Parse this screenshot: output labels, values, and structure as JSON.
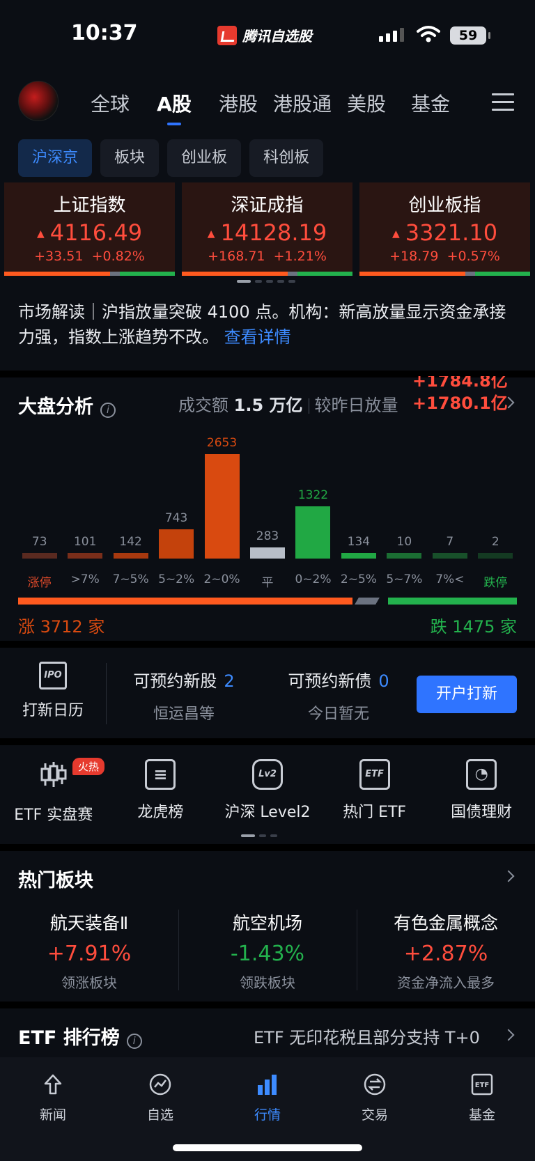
{
  "status_bar": {
    "time": "10:37",
    "app_name": "腾讯自选股",
    "battery": "59"
  },
  "top_nav": {
    "tabs": [
      {
        "label": "全球",
        "active": false
      },
      {
        "label": "A股",
        "active": true
      },
      {
        "label": "港股",
        "active": false
      },
      {
        "label": "港股通",
        "active": false
      },
      {
        "label": "美股",
        "active": false
      },
      {
        "label": "基金",
        "active": false
      }
    ]
  },
  "sub_tabs": [
    {
      "label": "沪深京",
      "active": true
    },
    {
      "label": "板块",
      "active": false
    },
    {
      "label": "创业板",
      "active": false
    },
    {
      "label": "科创板",
      "active": false
    }
  ],
  "indices": [
    {
      "name": "上证指数",
      "value": "4116.49",
      "change": "+33.51",
      "pct": "+0.82%",
      "up_ratio": 0.72
    },
    {
      "name": "深证成指",
      "value": "14128.19",
      "change": "+168.71",
      "pct": "+1.21%",
      "up_ratio": 0.72
    },
    {
      "name": "创业板指",
      "value": "3321.10",
      "change": "+18.79",
      "pct": "+0.57%",
      "up_ratio": 0.72
    }
  ],
  "market_interpretation": {
    "text": "市场解读｜沪指放量突破 4100 点。机构：新高放量显示资金承接力强，指数上涨趋势不改。",
    "link": "查看详情"
  },
  "market_analysis": {
    "title": "大盘分析",
    "turnover_label": "成交额",
    "turnover_value": "1.5 万亿",
    "compare_label": "较昨日放量",
    "compare_values": [
      "+1784.8亿",
      "+1780.1亿"
    ],
    "rise_label": "涨 3712 家",
    "fall_label": "跌 1475 家",
    "rise_count": 3712,
    "flat_count": 283,
    "fall_count": 1475
  },
  "chart_data": {
    "type": "bar",
    "title": "",
    "categories": [
      "涨停",
      ">7%",
      "7~5%",
      "5~2%",
      "2~0%",
      "平",
      "0~2%",
      "2~5%",
      "5~7%",
      "7%<",
      "跌停"
    ],
    "values": [
      73,
      101,
      142,
      743,
      2653,
      283,
      1322,
      134,
      10,
      7,
      2
    ],
    "colors": [
      "#5a2a20",
      "#7a2e1a",
      "#a8390f",
      "#c4420c",
      "#d94a10",
      "#b8bec8",
      "#21a844",
      "#21a844",
      "#1b6e33",
      "#18502a",
      "#143a22"
    ],
    "label_colors": [
      "#e04a2a",
      "#8a909c",
      "#8a909c",
      "#8a909c",
      "#8a909c",
      "#8a909c",
      "#8a909c",
      "#8a909c",
      "#8a909c",
      "#8a909c",
      "#23b14d"
    ],
    "value_colors": [
      "#8a909c",
      "#8a909c",
      "#8a909c",
      "#8a909c",
      "#d94a10",
      "#8a909c",
      "#21a844",
      "#8a909c",
      "#8a909c",
      "#8a909c",
      "#8a909c"
    ],
    "xlabel": "",
    "ylabel": ""
  },
  "ipo": {
    "calendar_label": "打新日历",
    "calendar_icon_text": "IPO",
    "stocks_label": "可预约新股",
    "stocks_count": "2",
    "stocks_sub": "恒运昌等",
    "bonds_label": "可预约新债",
    "bonds_count": "0",
    "bonds_sub": "今日暂无",
    "button": "开户打新"
  },
  "shortcuts": [
    {
      "label": "ETF 实盘赛",
      "icon": "candlestick-icon",
      "glyph": "",
      "badge": "火热"
    },
    {
      "label": "龙虎榜",
      "icon": "list-doc-icon",
      "glyph": "≡",
      "badge": ""
    },
    {
      "label": "沪深 Level2",
      "icon": "lv2-icon",
      "glyph": "Lv2",
      "badge": ""
    },
    {
      "label": "热门 ETF",
      "icon": "etf-icon",
      "glyph": "ETF",
      "badge": ""
    },
    {
      "label": "国债理财",
      "icon": "bond-icon",
      "glyph": "◔",
      "badge": ""
    }
  ],
  "hot_sectors": {
    "title": "热门板块",
    "items": [
      {
        "name": "航天装备Ⅱ",
        "pct": "+7.91%",
        "desc": "领涨板块",
        "color": "#ff4d3d"
      },
      {
        "name": "航空机场",
        "pct": "-1.43%",
        "desc": "领跌板块",
        "color": "#23b14d"
      },
      {
        "name": "有色金属概念",
        "pct": "+2.87%",
        "desc": "资金净流入最多",
        "color": "#ff4d3d"
      }
    ]
  },
  "etf_rank": {
    "title": "ETF 排行榜",
    "note": "ETF 无印花税且部分支持 T+0"
  },
  "bottom_nav": [
    {
      "label": "新闻",
      "icon": "news-icon",
      "active": false
    },
    {
      "label": "自选",
      "icon": "watchlist-icon",
      "active": false
    },
    {
      "label": "行情",
      "icon": "market-icon",
      "active": true
    },
    {
      "label": "交易",
      "icon": "trade-icon",
      "active": false
    },
    {
      "label": "基金",
      "icon": "fund-icon",
      "active": false
    }
  ]
}
